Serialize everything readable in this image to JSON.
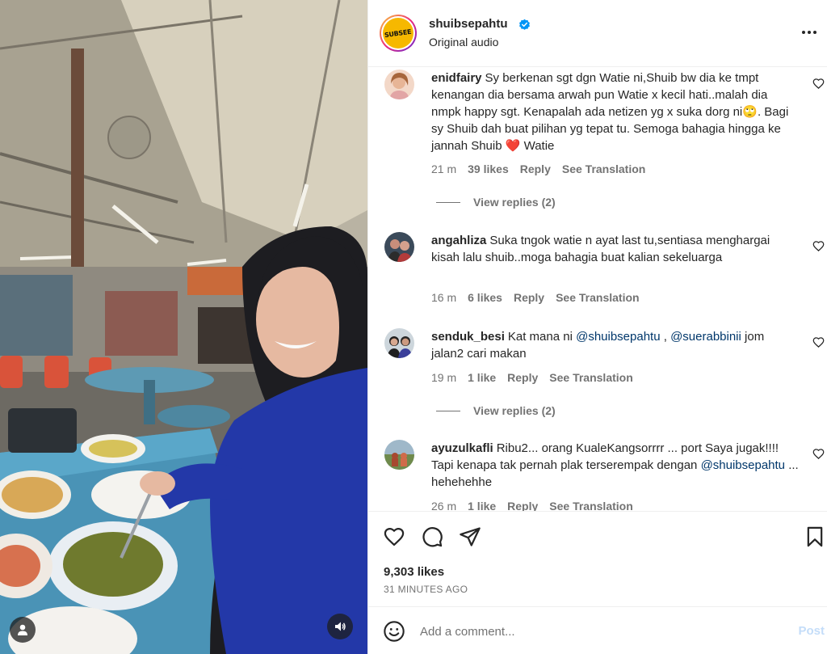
{
  "header": {
    "username": "shuibsepahtu",
    "audio_label": "Original audio",
    "logo_text": "SUBSEE"
  },
  "comments": [
    {
      "username": "enidfairy",
      "text": "Sy berkenan sgt dgn Watie ni,Shuib bw dia ke tmpt kenangan dia bersama arwah pun Watie x kecil hati..malah dia nmpk happy sgt. Kenapalah ada netizen yg x suka dorg ni",
      "text2": ". Bagi sy Shuib dah buat pilihan yg tepat tu. Semoga bahagia hingga ke jannah Shuib ",
      "text3": " Watie",
      "emoji1": "🙄",
      "emoji2": "❤️",
      "time": "21 m",
      "likes": "39 likes",
      "reply": "Reply",
      "translate": "See Translation",
      "view_replies": "View replies (2)"
    },
    {
      "username": "angahliza",
      "text": "Suka tngok watie n ayat last tu,sentiasa menghargai kisah lalu shuib..moga bahagia buat kalian sekeluarga",
      "time": "16 m",
      "likes": "6 likes",
      "reply": "Reply",
      "translate": "See Translation"
    },
    {
      "username": "senduk_besi",
      "text_before": "Kat mana ni ",
      "mention1": "@shuibsepahtu",
      "sep": " , ",
      "mention2": "@suerabbinii",
      "text_after": " jom jalan2 cari makan",
      "time": "19 m",
      "likes": "1 like",
      "reply": "Reply",
      "translate": "See Translation",
      "view_replies": "View replies (2)"
    },
    {
      "username": "ayuzulkafli",
      "text_before": "Ribu2... orang KualeKangsorrrr ... port Saya jugak!!!! Tapi kenapa tak pernah plak terserempak dengan ",
      "mention1": "@shuibsepahtu",
      "text_after": " ... hehehehhe",
      "time": "26 m",
      "likes": "1 like",
      "reply": "Reply",
      "translate": "See Translation"
    }
  ],
  "actions": {
    "likes": "9,303 likes",
    "time": "31 MINUTES AGO"
  },
  "add_comment": {
    "placeholder": "Add a comment...",
    "post_label": "Post"
  },
  "colors": {
    "link": "#00376b",
    "secondary": "#737373",
    "post_disabled": "#c4ddf9",
    "verified": "#0095f6"
  }
}
